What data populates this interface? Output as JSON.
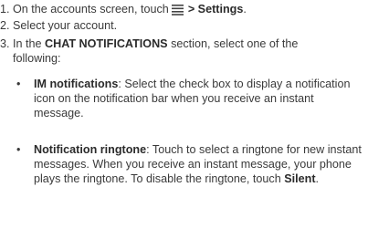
{
  "steps": [
    {
      "number": "1.",
      "text_before": "On the accounts screen, touch",
      "icon": "menu-icon",
      "bold_text": "> Settings",
      "text_after": "."
    },
    {
      "number": "2.",
      "text": "Select your account."
    },
    {
      "number": "3.",
      "text_before": "In the",
      "bold_text": "CHAT NOTIFICATIONS",
      "text_after": "section, select one of the following:"
    }
  ],
  "bullets": [
    {
      "marker": "•",
      "term": "IM notifications",
      "description": ": Select the check box to display a notification icon on the notification bar when you receive an instant message."
    },
    {
      "marker": "•",
      "term": "Notification ringtone",
      "description_before": ": Touch to select a ringtone for new instant messages. When you receive an instant message, your phone plays the ringtone. To disable the ringtone, touch",
      "bold_text": "Silent",
      "description_after": "."
    }
  ]
}
